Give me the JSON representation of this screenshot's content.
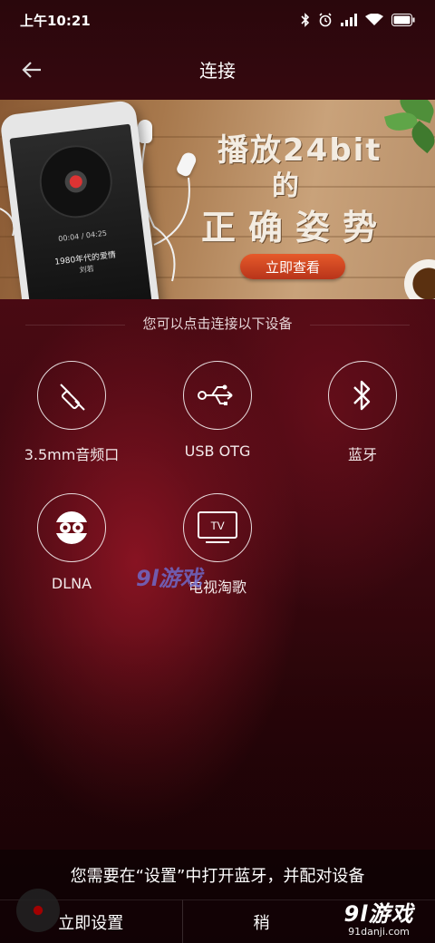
{
  "status_bar": {
    "time": "上午10:21"
  },
  "header": {
    "title": "连接"
  },
  "banner": {
    "line1": "播放24bit",
    "line2": "的",
    "line3": "正确姿势",
    "button_label": "立即查看",
    "phone_time": "00:04 / 04:25",
    "phone_song": "1980年代的爱情",
    "phone_artist": "刘若"
  },
  "hint": "您可以点击连接以下设备",
  "devices": [
    {
      "label": "3.5mm音频口",
      "icon": "headphone-jack-icon"
    },
    {
      "label": "USB OTG",
      "icon": "usb-icon"
    },
    {
      "label": "蓝牙",
      "icon": "bluetooth-icon"
    },
    {
      "label": "DLNA",
      "icon": "dlna-icon"
    },
    {
      "label": "电视淘歌",
      "icon": "tv-icon"
    }
  ],
  "tv_text": "TV",
  "watermark": {
    "center": "9l游戏",
    "logo": "9l游戏",
    "site": "91danji.com"
  },
  "message": "您需要在“设置”中打开蓝牙，并配对设备",
  "bottom": {
    "set_now": "立即设置",
    "later": "稍"
  }
}
